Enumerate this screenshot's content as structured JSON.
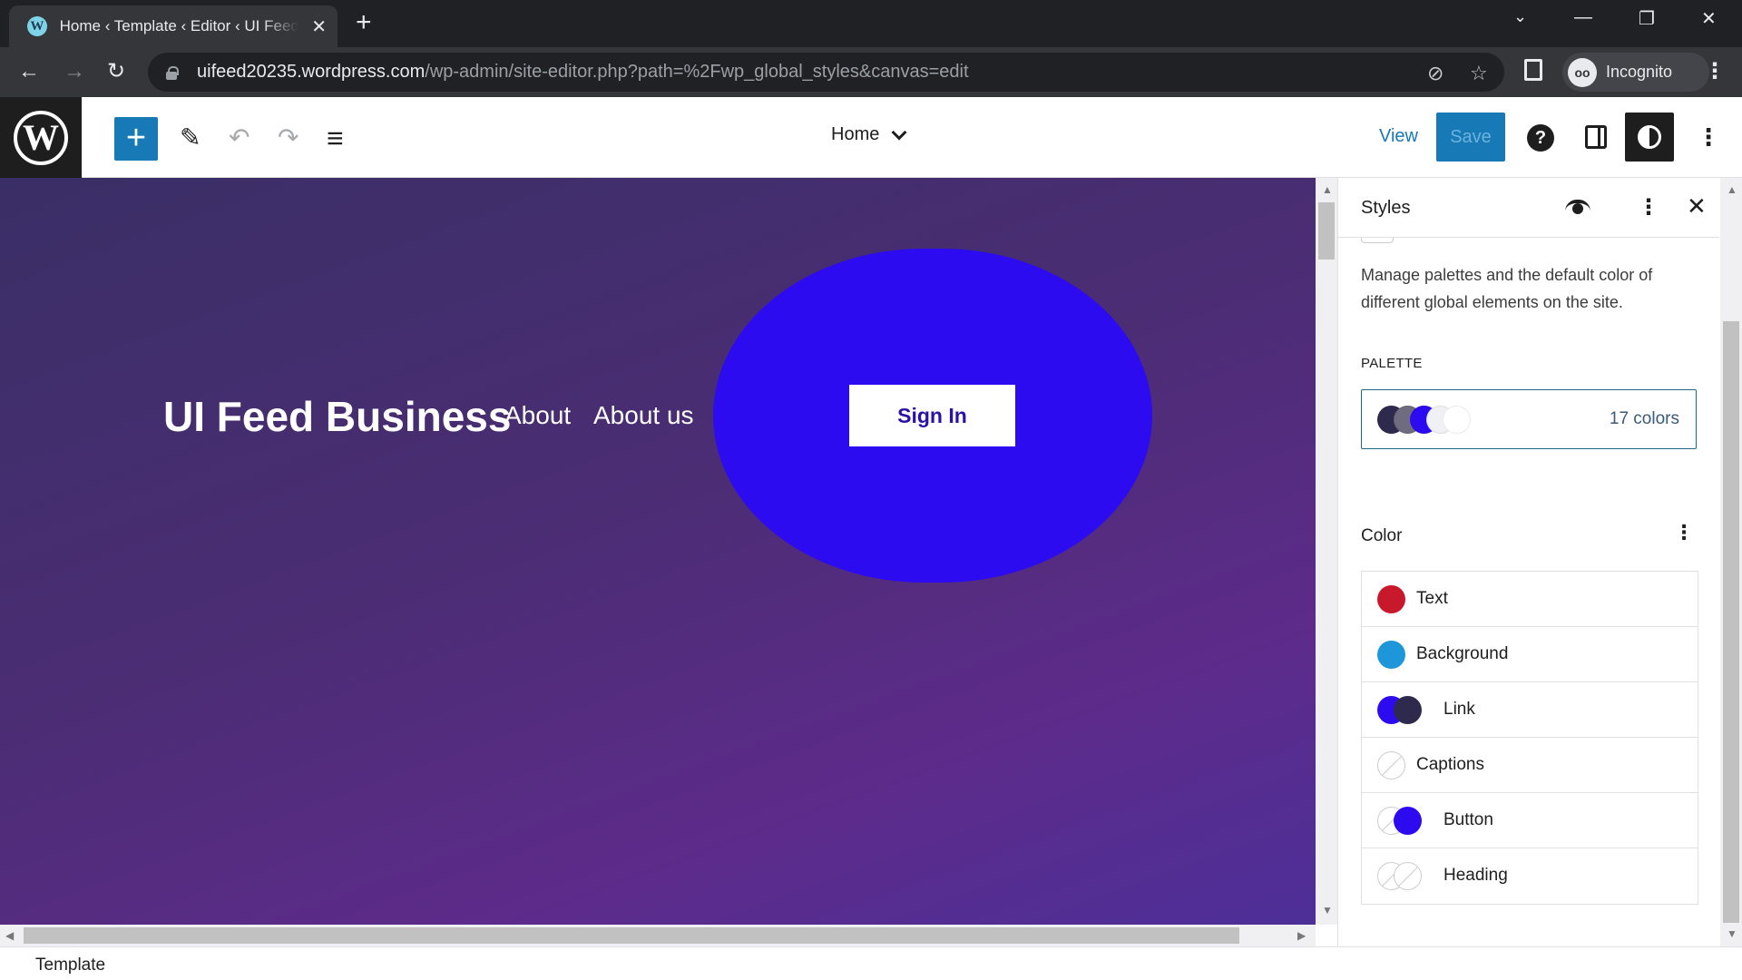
{
  "browser": {
    "tab_title": "Home ‹ Template ‹ Editor ‹ UI Feed Business",
    "tab_favicon": "W",
    "new_tab": "+",
    "url_host": "uifeed20235.wordpress.com",
    "url_path": "/wp-admin/site-editor.php?path=%2Fwp_global_styles&canvas=edit",
    "profile_label": "Incognito",
    "icons": {
      "tab_close": "✕",
      "back": "←",
      "forward": "→",
      "reload": "↻",
      "tracking_off": "⊘",
      "bookmark": "☆",
      "tab_search": "⌄",
      "minimize": "—",
      "restore": "❐",
      "close": "✕",
      "menu": "⋮"
    }
  },
  "editor": {
    "logo": "W",
    "inserter": "+",
    "icons": {
      "tools": "✎",
      "undo": "↶",
      "redo": "↷",
      "list_view": "≡",
      "help": "?",
      "more": "⋮"
    },
    "document_title": "Home",
    "view_label": "View",
    "save_label": "Save"
  },
  "canvas": {
    "site_title": "UI Feed Business",
    "nav_links": [
      "About",
      "About us"
    ],
    "signin_label": "Sign In",
    "blob_color": "#2d0bf0"
  },
  "sidebar": {
    "title": "Styles",
    "more": "⋮",
    "close": "✕",
    "description": "Manage palettes and the default color of different global elements on the site.",
    "palette_label": "Palette",
    "palette_swatches": [
      "#2e2a4d",
      "#6e6c7e",
      "#2d0bf0",
      "#f0f0f5",
      "#ffffff"
    ],
    "palette_count": "17 colors",
    "color_heading": "Color",
    "color_more": "⋮",
    "elements": [
      {
        "label": "Text",
        "colors": [
          "#c8192c"
        ]
      },
      {
        "label": "Background",
        "colors": [
          "#1d97d9"
        ]
      },
      {
        "label": "Link",
        "colors": [
          "#2d0bf0",
          "#2e2a4d"
        ]
      },
      {
        "label": "Captions",
        "colors": [
          null
        ]
      },
      {
        "label": "Button",
        "colors": [
          null,
          "#2d0bf0"
        ]
      },
      {
        "label": "Heading",
        "colors": [
          null,
          null
        ]
      }
    ]
  },
  "statusbar": {
    "label": "Template"
  }
}
